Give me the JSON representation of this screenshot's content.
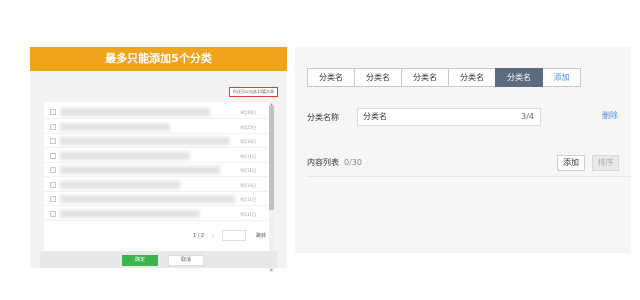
{
  "left_dialog": {
    "banner_title": "最多只能添加5个分类",
    "remaining_note": "你还可以勾选30篇文章",
    "rows": [
      {
        "date": "9月30日"
      },
      {
        "date": "9月25日"
      },
      {
        "date": "9月16日"
      },
      {
        "date": "9月11日"
      },
      {
        "date": "9月11日"
      },
      {
        "date": "9月14日"
      },
      {
        "date": "9月11日"
      },
      {
        "date": "9月11日"
      }
    ],
    "pager": {
      "page": "1 / 2",
      "next": "›",
      "goto_label": "跳转"
    },
    "confirm_label": "确定",
    "cancel_label": "取消"
  },
  "right_panel": {
    "tabs": [
      {
        "label": "分类名",
        "active": false
      },
      {
        "label": "分类名",
        "active": false
      },
      {
        "label": "分类名",
        "active": false
      },
      {
        "label": "分类名",
        "active": false
      },
      {
        "label": "分类名",
        "active": true
      }
    ],
    "add_tab_label": "添加",
    "name_label": "分类名称",
    "name_value": "分类名",
    "name_count": "3/4",
    "delete_label": "删除",
    "content_label": "内容列表",
    "content_count": "0/30",
    "add_button": "添加",
    "sort_button": "排序",
    "colors": {
      "active_tab": "#5d6b7e",
      "link": "#4a8fd6",
      "banner": "#f0a31b",
      "confirm": "#3cb44b",
      "warning_border": "#e03a3a"
    }
  }
}
